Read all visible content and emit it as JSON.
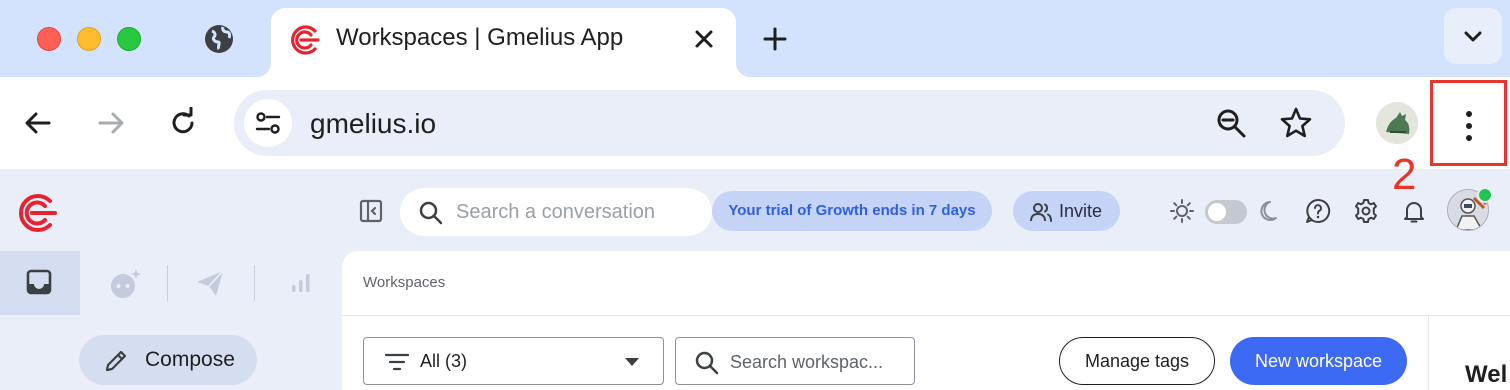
{
  "browser": {
    "tab_title": "Workspaces | Gmelius App",
    "url": "gmelius.io",
    "icons": [
      "globe-icon",
      "close-icon",
      "plus-icon",
      "chevron-down-icon",
      "back-arrow-icon",
      "forward-arrow-icon",
      "reload-icon",
      "site-settings-icon",
      "zoom-out-icon",
      "star-icon",
      "profile-avatar",
      "more-vert-icon"
    ]
  },
  "annotation": {
    "step_number": "2",
    "color": "#e8352a"
  },
  "header": {
    "search_placeholder": "Search a conversation",
    "trial_text": "Your trial of Growth ends in 7 days",
    "invite_label": "Invite"
  },
  "nav": {
    "compose_label": "Compose",
    "tabs": [
      "inbox-icon",
      "bot-icon",
      "send-icon",
      "analytics-icon"
    ]
  },
  "main": {
    "breadcrumb": "Workspaces",
    "filter_label": "All (3)",
    "search_placeholder": "Search workspac...",
    "manage_tags_label": "Manage tags",
    "new_workspace_label": "New workspace",
    "welcome_partial": "Wel"
  },
  "colors": {
    "brand_red": "#e8232f",
    "primary_blue": "#3d6af2",
    "trial_text": "#2f5fde",
    "pill_bg": "#c5d4f6",
    "online_status": "#23c552"
  }
}
